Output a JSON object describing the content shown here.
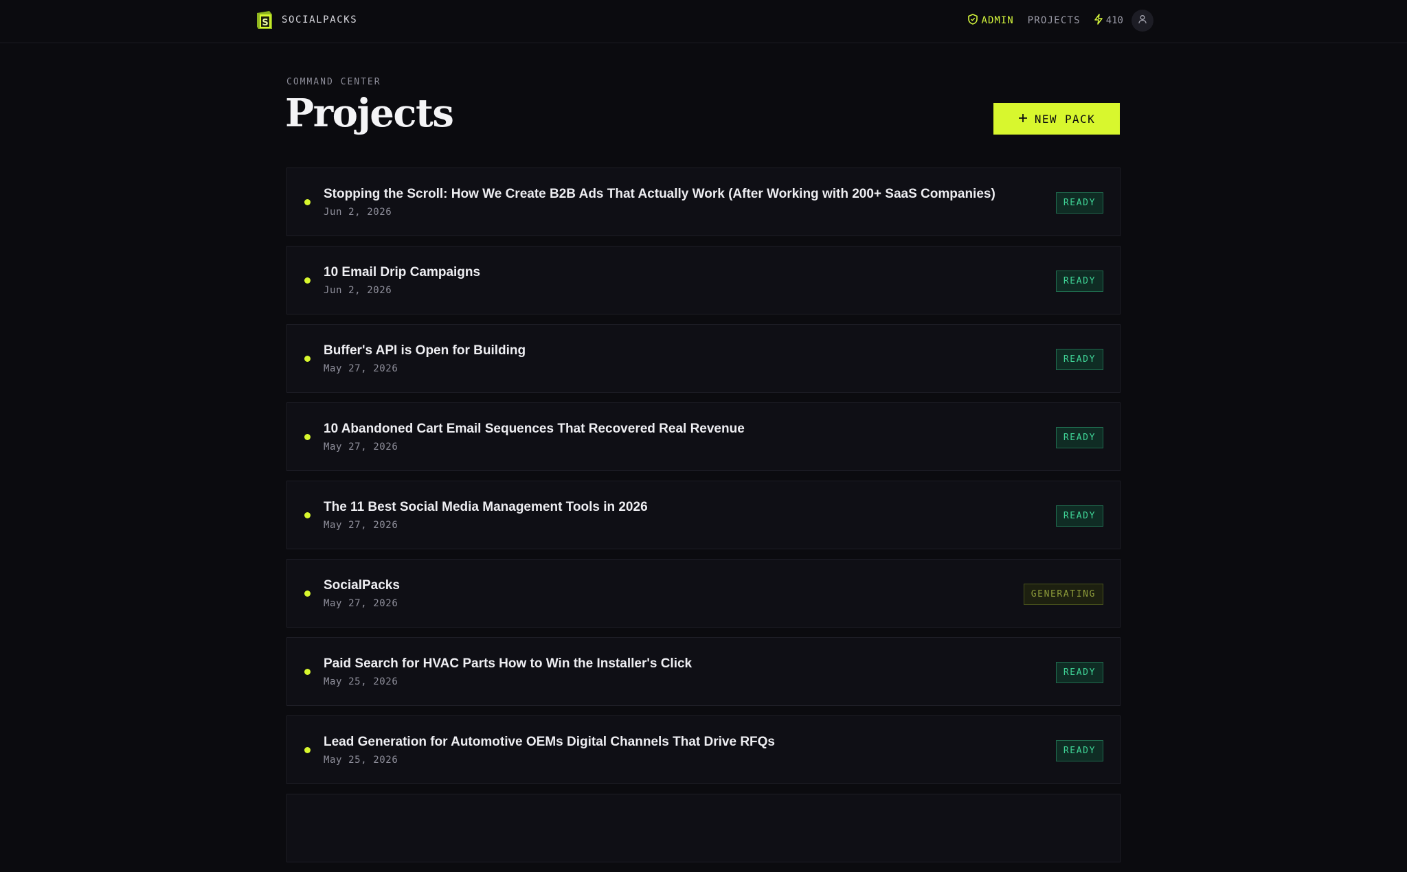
{
  "header": {
    "brand_name": "SOCIALPACKS",
    "admin_label": "ADMIN",
    "projects_label": "PROJECTS",
    "credits": "410",
    "accent_color": "#d8f72e"
  },
  "main": {
    "eyebrow": "COMMAND CENTER",
    "title": "Projects",
    "new_pack_label": "NEW PACK",
    "projects": [
      {
        "title": "Stopping the Scroll: How We Create B2B Ads That Actually Work (After Working with 200+ SaaS Companies)",
        "date": "Jun 2, 2026",
        "status": "READY"
      },
      {
        "title": "10 Email Drip Campaigns",
        "date": "Jun 2, 2026",
        "status": "READY"
      },
      {
        "title": "Buffer's API is Open for Building",
        "date": "May 27, 2026",
        "status": "READY"
      },
      {
        "title": "10 Abandoned Cart Email Sequences That Recovered Real Revenue",
        "date": "May 27, 2026",
        "status": "READY"
      },
      {
        "title": "The 11 Best Social Media Management Tools in 2026",
        "date": "May 27, 2026",
        "status": "READY"
      },
      {
        "title": "SocialPacks",
        "date": "May 27, 2026",
        "status": "GENERATING"
      },
      {
        "title": "Paid Search for HVAC Parts How to Win the Installer's Click",
        "date": "May 25, 2026",
        "status": "READY"
      },
      {
        "title": "Lead Generation for Automotive OEMs Digital Channels That Drive RFQs",
        "date": "May 25, 2026",
        "status": "READY"
      },
      {
        "title": "",
        "date": "",
        "status": ""
      }
    ]
  }
}
